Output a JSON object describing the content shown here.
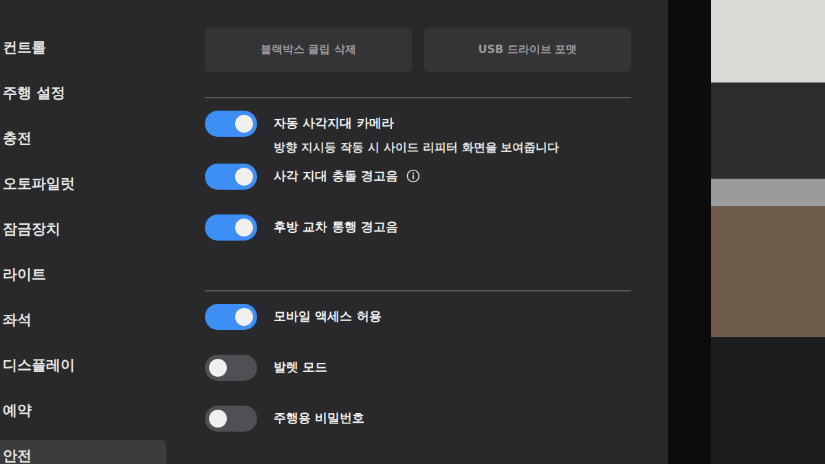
{
  "sidebar": {
    "items": [
      {
        "label": "컨트롤",
        "selected": false
      },
      {
        "label": "주행 설정",
        "selected": false
      },
      {
        "label": "충전",
        "selected": false
      },
      {
        "label": "오토파일럿",
        "selected": false
      },
      {
        "label": "잠금장치",
        "selected": false
      },
      {
        "label": "라이트",
        "selected": false
      },
      {
        "label": "좌석",
        "selected": false
      },
      {
        "label": "디스플레이",
        "selected": false
      },
      {
        "label": "예약",
        "selected": false
      },
      {
        "label": "안전",
        "selected": true
      }
    ]
  },
  "buttons": [
    "블랙박스 클립 삭제",
    "USB 드라이브 포맷"
  ],
  "groups": [
    [
      {
        "label": "자동 사각지대 카메라",
        "description": "방향 지시등 작동 시 사이드 리피터 화면을 보여줍니다",
        "on": true,
        "info": false
      },
      {
        "label": "사각 지대 충돌 경고음",
        "description": "",
        "on": true,
        "info": true
      },
      {
        "label": "후방 교차 통행 경고음",
        "description": "",
        "on": true,
        "info": false
      }
    ],
    [
      {
        "label": "모바일 액세스 허용",
        "description": "",
        "on": true,
        "info": false
      },
      {
        "label": "발렛 모드",
        "description": "",
        "on": false,
        "info": false
      },
      {
        "label": "주행용 비밀번호",
        "description": "",
        "on": false,
        "info": false
      }
    ]
  ]
}
